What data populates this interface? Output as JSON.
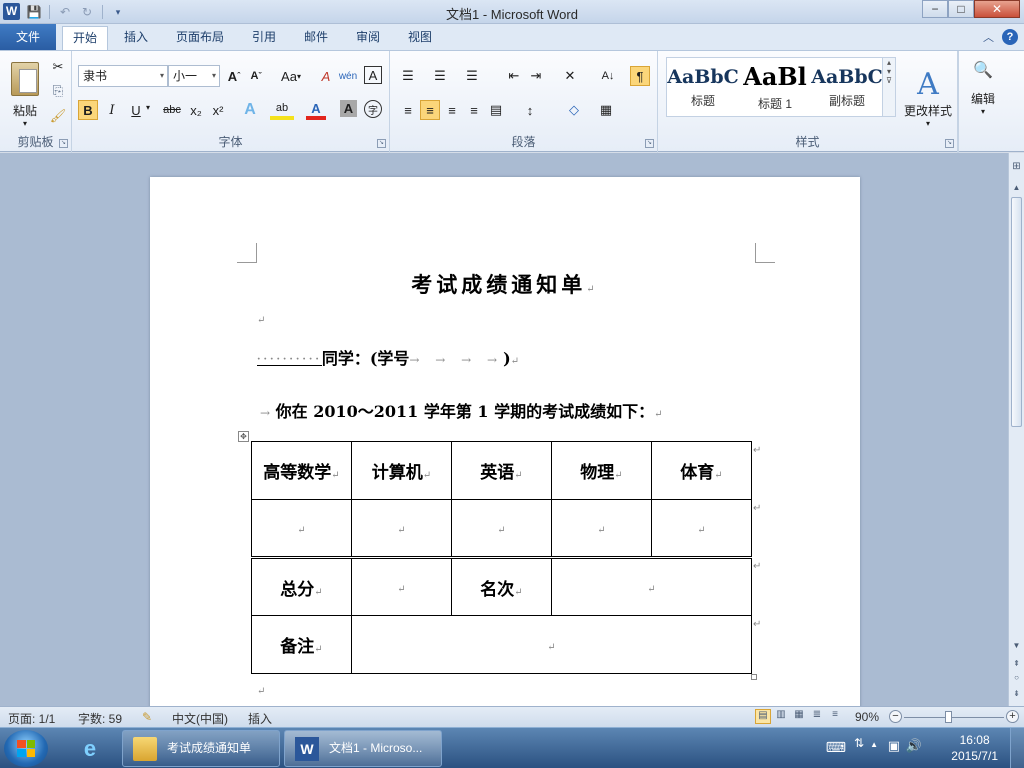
{
  "window": {
    "title": "文档1 - Microsoft Word",
    "app_icon": "W",
    "controls": {
      "minimize": "−",
      "maximize": "□",
      "close": "✕"
    }
  },
  "qat": {
    "save_icon": "💾",
    "undo_icon": "↶",
    "redo_icon": "↻",
    "more_icon": "▾"
  },
  "ribbon_tabs": {
    "file": "文件",
    "items": [
      "开始",
      "插入",
      "页面布局",
      "引用",
      "邮件",
      "审阅",
      "视图"
    ],
    "active": "开始",
    "collapse_icon": "︿",
    "help_icon": "?"
  },
  "clipboard": {
    "paste": "粘贴",
    "cut_icon": "✂",
    "copy_icon": "⎘",
    "format_painter_icon": "🖌",
    "label": "剪贴板"
  },
  "font": {
    "font_name": "隶书",
    "font_size": "小一",
    "grow_icon": "A",
    "grow_sup": "ˆ",
    "shrink_icon": "A",
    "shrink_sup": "ˇ",
    "case_icon": "Aa",
    "clear_icon": "A",
    "phonetic_icon": "文",
    "wen_icon": "wén",
    "border_char_icon": "A",
    "bold": "B",
    "italic": "I",
    "underline": "U",
    "strike": "abc",
    "subscript": "x₂",
    "superscript": "x²",
    "text_effect_icon": "A",
    "highlight_icon": "ab",
    "color_icon": "A",
    "shading_icon": "A",
    "enclose_icon": "字",
    "label": "字体"
  },
  "paragraph": {
    "label": "段落",
    "bullets_icon": "☰",
    "numbering_icon": "☰",
    "multilevel_icon": "☰",
    "decrease_indent_icon": "⇤",
    "increase_indent_icon": "⇥",
    "chinese_layout_icon": "✕",
    "sort_icon": "A↓",
    "show_marks_icon": "¶",
    "align_left_icon": "≡",
    "align_center_icon": "≡",
    "align_right_icon": "≡",
    "justify_icon": "≡",
    "distributed_icon": "▤",
    "line_spacing_icon": "↕",
    "shading_icon": "◇",
    "border_icon": "▦"
  },
  "styles": {
    "label": "样式",
    "items": [
      {
        "sample": "AaBbC",
        "name": "标题"
      },
      {
        "sample": "AaBl",
        "name": "标题 1"
      },
      {
        "sample": "AaBbC",
        "name": "副标题"
      }
    ],
    "change_styles": "更改样式",
    "change_styles_icon": "A"
  },
  "editing": {
    "label": "编辑",
    "icon": "🔍"
  },
  "document": {
    "title": "考试成绩通知单",
    "para_mark": "↵",
    "greeting_dots": "··········",
    "greeting": "同学：(学号",
    "greeting_arrows": "→ → → →",
    "greeting_close": ")",
    "intro_arrow": "→",
    "intro": "你在 2010～2011 学年第 1 学期的考试成绩如下：",
    "table": {
      "subjects": [
        "高等数学",
        "计算机",
        "英语",
        "物理",
        "体育"
      ],
      "total_label": "总分",
      "rank_label": "名次",
      "remark_label": "备注"
    },
    "move_handle_icon": "✥"
  },
  "statusbar": {
    "page": "页面: 1/1",
    "words": "字数: 59",
    "language": "中文(中国)",
    "insert_mode": "插入",
    "zoom": "90%",
    "zoom_minus": "−",
    "zoom_plus": "+"
  },
  "taskbar": {
    "ie_icon": "e",
    "folder_task": "考试成绩通知单",
    "word_task": "文档1 - Microso...",
    "time": "16:08",
    "date": "2015/7/1",
    "tray_icons": [
      "⌨",
      "⇅",
      "▲",
      "▣",
      "🔊"
    ]
  }
}
